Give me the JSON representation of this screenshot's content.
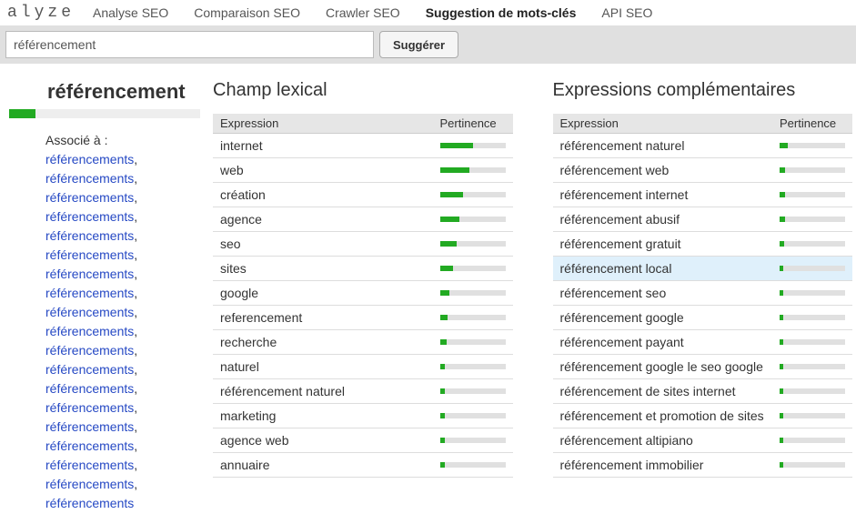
{
  "logo": "alyze",
  "nav": [
    {
      "label": "Analyse SEO",
      "active": false
    },
    {
      "label": "Comparaison SEO",
      "active": false
    },
    {
      "label": "Crawler SEO",
      "active": false
    },
    {
      "label": "Suggestion de mots-clés",
      "active": true
    },
    {
      "label": "API SEO",
      "active": false
    }
  ],
  "search": {
    "value": "référencement",
    "button": "Suggérer"
  },
  "keyword": {
    "title": "référencement",
    "bar_pct": 14
  },
  "associated": {
    "label": "Associé à : ",
    "items": [
      "référencements",
      "référencements",
      "référencements",
      "référencements",
      "référencements",
      "référencements",
      "référencements",
      "référencements",
      "référencements",
      "référencements",
      "référencements",
      "référencements",
      "référencements",
      "référencements",
      "référencements",
      "référencements",
      "référencements",
      "référencements",
      "référencements"
    ]
  },
  "lexical": {
    "title": "Champ lexical",
    "headers": {
      "expr": "Expression",
      "pert": "Pertinence"
    },
    "rows": [
      {
        "expr": "internet",
        "pert": 50
      },
      {
        "expr": "web",
        "pert": 45
      },
      {
        "expr": "création",
        "pert": 35
      },
      {
        "expr": "agence",
        "pert": 30
      },
      {
        "expr": "seo",
        "pert": 25
      },
      {
        "expr": "sites",
        "pert": 20
      },
      {
        "expr": "google",
        "pert": 15
      },
      {
        "expr": "referencement",
        "pert": 12
      },
      {
        "expr": "recherche",
        "pert": 10
      },
      {
        "expr": "naturel",
        "pert": 8
      },
      {
        "expr": "référencement naturel",
        "pert": 8
      },
      {
        "expr": "marketing",
        "pert": 8
      },
      {
        "expr": "agence web",
        "pert": 7
      },
      {
        "expr": "annuaire",
        "pert": 7
      }
    ]
  },
  "complementary": {
    "title": "Expressions complémentaires",
    "headers": {
      "expr": "Expression",
      "pert": "Pertinence"
    },
    "rows": [
      {
        "expr": "référencement naturel",
        "pert": 12,
        "hl": false
      },
      {
        "expr": "référencement web",
        "pert": 8,
        "hl": false
      },
      {
        "expr": "référencement internet",
        "pert": 8,
        "hl": false
      },
      {
        "expr": "référencement abusif",
        "pert": 8,
        "hl": false
      },
      {
        "expr": "référencement gratuit",
        "pert": 7,
        "hl": false
      },
      {
        "expr": "référencement local",
        "pert": 6,
        "hl": true
      },
      {
        "expr": "référencement seo",
        "pert": 6,
        "hl": false
      },
      {
        "expr": "référencement google",
        "pert": 6,
        "hl": false
      },
      {
        "expr": "référencement payant",
        "pert": 6,
        "hl": false
      },
      {
        "expr": "référencement google le seo google",
        "pert": 6,
        "hl": false
      },
      {
        "expr": "référencement de sites internet",
        "pert": 6,
        "hl": false
      },
      {
        "expr": "référencement et promotion de sites",
        "pert": 5,
        "hl": false
      },
      {
        "expr": "référencement altipiano",
        "pert": 5,
        "hl": false
      },
      {
        "expr": "référencement immobilier",
        "pert": 5,
        "hl": false
      }
    ]
  }
}
